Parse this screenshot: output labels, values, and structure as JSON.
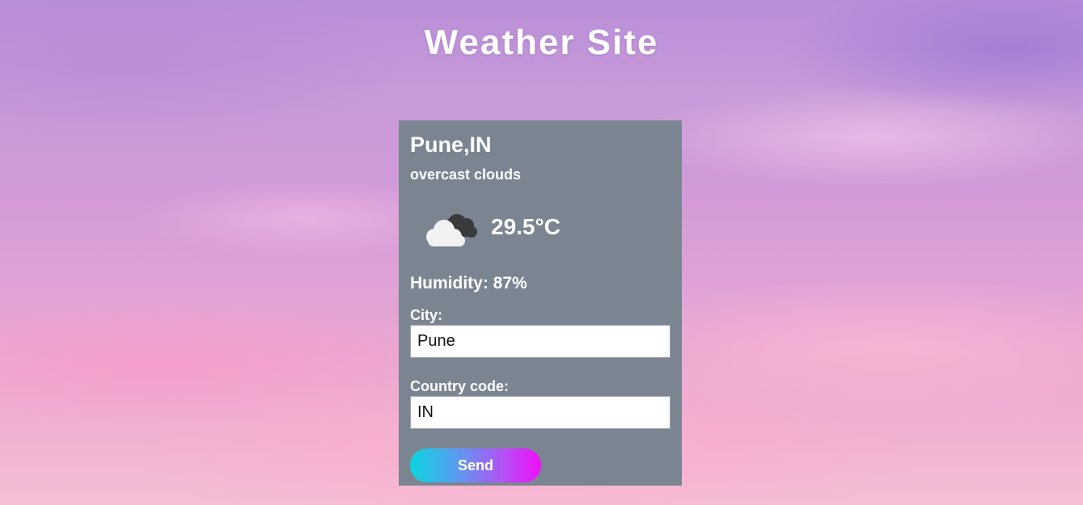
{
  "header": {
    "title": "Weather Site"
  },
  "weather": {
    "location": "Pune,IN",
    "description": "overcast clouds",
    "icon": "overcast-clouds-icon",
    "temperature": "29.5°C",
    "humidity_label": "Humidity: 87%"
  },
  "form": {
    "city_label": "City:",
    "city_value": "Pune",
    "country_label": "Country code:",
    "country_value": "IN",
    "send_label": "Send"
  },
  "colors": {
    "card_background": "#7a8591",
    "text": "#ffffff",
    "button_gradient_start": "#0bd6df",
    "button_gradient_end": "#f20dfa"
  }
}
